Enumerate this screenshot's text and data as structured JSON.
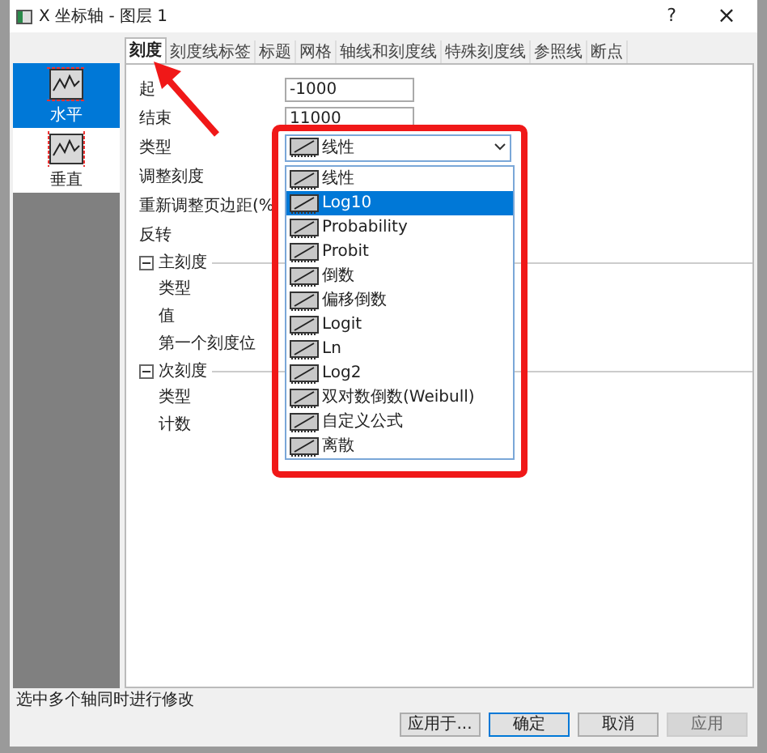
{
  "window": {
    "title": "X 坐标轴 - 图层 1",
    "help": "?",
    "close": "×"
  },
  "tabs": [
    {
      "label": "刻度",
      "selected": true
    },
    {
      "label": "刻度线标签",
      "selected": false
    },
    {
      "label": "标题",
      "selected": false
    },
    {
      "label": "网格",
      "selected": false
    },
    {
      "label": "轴线和刻度线",
      "selected": false
    },
    {
      "label": "特殊刻度线",
      "selected": false
    },
    {
      "label": "参照线",
      "selected": false
    },
    {
      "label": "断点",
      "selected": false
    }
  ],
  "sidebar": {
    "items": [
      {
        "label": "水平",
        "selected": true
      },
      {
        "label": "垂直",
        "selected": false
      }
    ]
  },
  "fields": [
    {
      "kind": "input",
      "label": "起",
      "value": "-1000"
    },
    {
      "kind": "input",
      "label": "结束",
      "value": "11000"
    },
    {
      "kind": "combo",
      "label": "类型",
      "value": "线性"
    },
    {
      "kind": "plain",
      "label": "调整刻度"
    },
    {
      "kind": "plain",
      "label": "重新调整页边距(%"
    },
    {
      "kind": "plain",
      "label": "反转"
    }
  ],
  "sections": [
    {
      "title": "主刻度",
      "expanded": true,
      "rows": [
        "类型",
        "值",
        "第一个刻度位"
      ]
    },
    {
      "title": "次刻度",
      "expanded": true,
      "rows": [
        "类型",
        "计数"
      ]
    }
  ],
  "dropdown": {
    "items": [
      {
        "label": "线性",
        "selected": false
      },
      {
        "label": "Log10",
        "selected": true
      },
      {
        "label": "Probability",
        "selected": false
      },
      {
        "label": "Probit",
        "selected": false
      },
      {
        "label": "倒数",
        "selected": false
      },
      {
        "label": "偏移倒数",
        "selected": false
      },
      {
        "label": "Logit",
        "selected": false
      },
      {
        "label": "Ln",
        "selected": false
      },
      {
        "label": "Log2",
        "selected": false
      },
      {
        "label": "双对数倒数(Weibull)",
        "selected": false
      },
      {
        "label": "自定义公式",
        "selected": false
      },
      {
        "label": "离散",
        "selected": false
      }
    ]
  },
  "status_bar": "选中多个轴同时进行修改",
  "buttons": [
    {
      "label": "应用于...",
      "default": false,
      "disabled": false
    },
    {
      "label": "确定",
      "default": true,
      "disabled": false
    },
    {
      "label": "取消",
      "default": false,
      "disabled": false
    },
    {
      "label": "应用",
      "default": false,
      "disabled": true
    }
  ]
}
